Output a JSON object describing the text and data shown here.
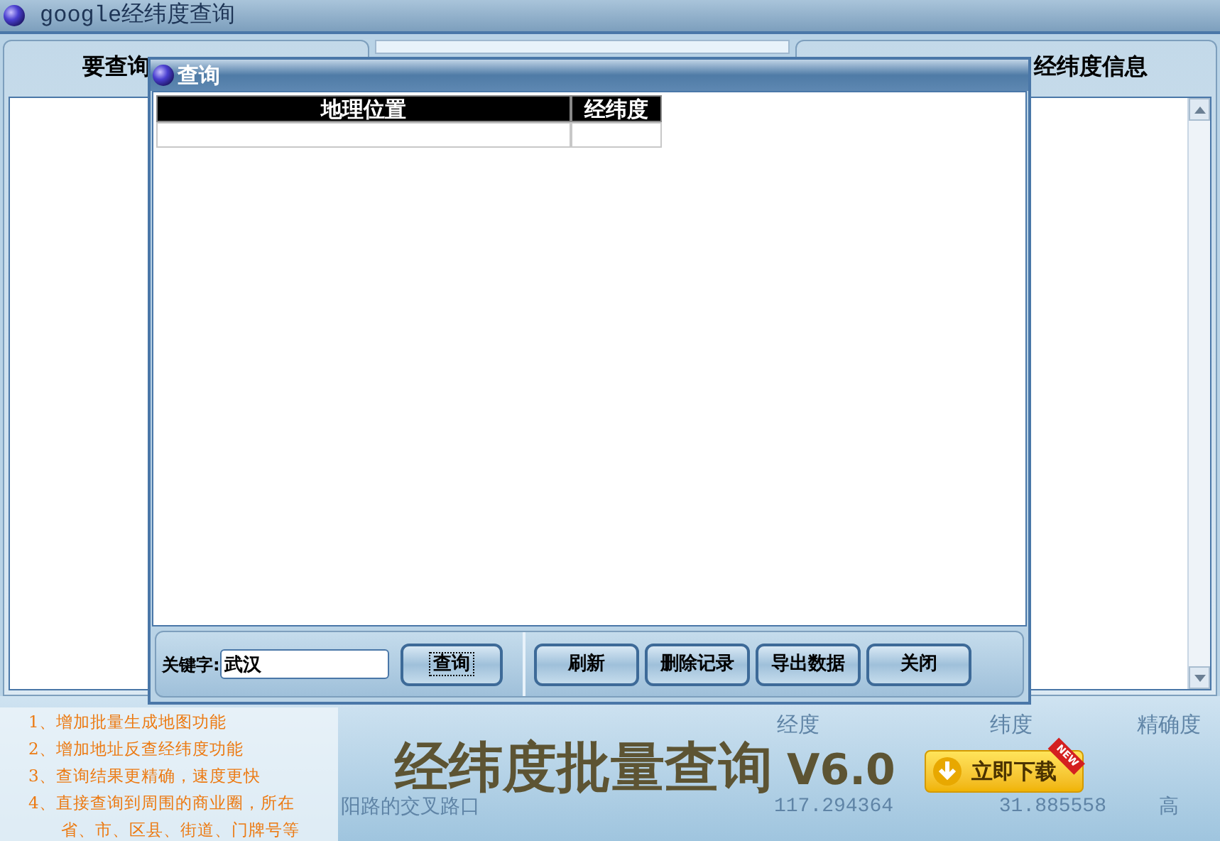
{
  "window": {
    "title": "google经纬度查询"
  },
  "main_panel": {
    "left_header": "要查询",
    "right_header": "经纬度信息"
  },
  "dialog": {
    "title": "查询",
    "table": {
      "columns": [
        "地理位置",
        "经纬度"
      ]
    },
    "keyword": {
      "label": "关键字:",
      "value": "武汉"
    },
    "search_button": "查询",
    "buttons": [
      "刷新",
      "删除记录",
      "导出数据",
      "关闭"
    ]
  },
  "banner": {
    "features": [
      "1、增加批量生成地图功能",
      "2、增加地址反查经纬度功能",
      "3、查询结果更精确，速度更快",
      "4、直接查询到周围的商业圈，所在",
      "省、市、区县、街道、门牌号等"
    ],
    "title": "经纬度批量查询",
    "version": "V6.0",
    "download_button": "立即下载",
    "new_badge": "NEW",
    "faint_columns": [
      "经度",
      "纬度",
      "精确度"
    ],
    "faint_rows": [
      [
        "117.294364",
        "31.885558",
        "高"
      ]
    ],
    "faint_text": "阳路的交叉路口"
  }
}
